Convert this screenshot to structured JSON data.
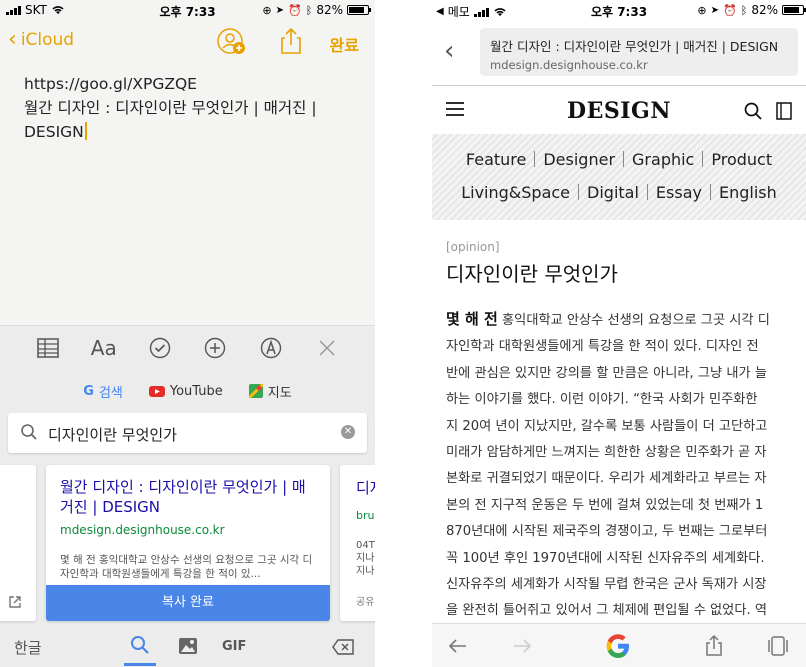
{
  "left": {
    "status": {
      "carrier": "SKT",
      "time": "오후 7:33",
      "battery": "82%"
    },
    "notes_nav": {
      "back_label": "iCloud",
      "done_label": "완료"
    },
    "note_lines": [
      "https://goo.gl/XPGZQE",
      "월간 디자인 : 디자인이란 무엇인가 | 매거진 |",
      "DESIGN"
    ],
    "keyboard": {
      "quick_links": [
        {
          "label": "검색",
          "icon": "google-g-icon"
        },
        {
          "label": "YouTube",
          "icon": "youtube-icon"
        },
        {
          "label": "지도",
          "icon": "maps-icon"
        }
      ],
      "search_query": "디자인이란 무엇인가",
      "result_card": {
        "title": "월간 디자인 : 디자인이란 무엇인가 | 매거진 | DESIGN",
        "url": "mdesign.designhouse.co.kr",
        "snippet": "몇 해 전 홍익대학교 안상수 선생의 요청으로 그곳 시각 디자인학과 대학원생들에게 특강을 한 적이 있...",
        "action_label": "복사 완료"
      },
      "peek_card": {
        "title": "디자",
        "url": "bru",
        "snippet_lines": [
          "04T",
          "지나",
          "지나"
        ],
        "share_label": "공유"
      },
      "bottom": {
        "lang_label": "한글",
        "gif_label": "GIF"
      }
    }
  },
  "right": {
    "status": {
      "back_app": "메모",
      "time": "오후 7:33",
      "battery": "82%"
    },
    "url_bar": {
      "title": "월간 디자인 : 디자인이란 무엇인가 | 매거진 | DESIGN",
      "domain": "mdesign.designhouse.co.kr"
    },
    "site": {
      "logo": "DESIGN",
      "menu_row1": [
        "Feature",
        "Designer",
        "Graphic",
        "Product"
      ],
      "menu_row2": [
        "Living&Space",
        "Digital",
        "Essay",
        "English"
      ]
    },
    "article": {
      "category": "[opinion]",
      "title": "디자인이란 무엇인가",
      "lead": "몇 해 전",
      "first_line_rest": " 홍익대학교 안상수 선생의 요청으로 그곳 시각 디",
      "lines": [
        "자인학과 대학원생들에게 특강을 한 적이 있다. 디자인 전",
        "반에 관심은 있지만 강의를 할 만큼은 아니라, 그냥 내가 늘",
        "하는 이야기를 했다. 이런 이야기. “한국 사회가 민주화한",
        "지 20여 년이 지났지만, 갈수록 보통 사람들이 더 고단하고",
        "미래가 암담하게만 느껴지는 희한한 상황은 민주화가 곧 자",
        "본화로 귀결되었기 때문이다. 우리가 세계화라고 부르는 자",
        "본의 전 지구적 운동은 두 번에 걸쳐 있었는데 첫 번째가 1",
        "870년대에 시작된 제국주의 경쟁이고, 두 번째는 그로부터",
        "꼭 100년 후인 1970년대에 시작된 신자유주의 세계화다.",
        "신자유주의 세계화가 시작될 무렵 한국은 군사 독재가 시장",
        "을 완전히 틀어쥐고 있어서 그 체제에 편입될 수 없었다. 역"
      ]
    }
  }
}
